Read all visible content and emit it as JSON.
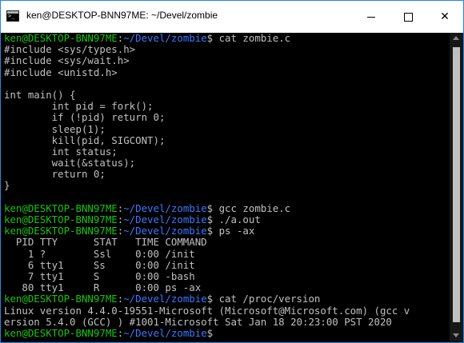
{
  "window": {
    "title": "ken@DESKTOP-BNN97ME: ~/Devel/zombie",
    "accent": "#1e88e5"
  },
  "colors": {
    "background": "#000000",
    "text": "#c0c0c0",
    "prompt_user": "#16c60c",
    "prompt_path": "#3b78ff"
  },
  "icons": {
    "app": "terminal-icon",
    "minimize": "minimize-icon",
    "maximize": "maximize-icon",
    "close": "close-icon"
  },
  "terminal": {
    "lines": [
      {
        "user": "ken@DESKTOP-BNN97ME",
        "sep": ":",
        "path": "~/Devel/zombie",
        "text": "$ cat zombie.c"
      },
      {
        "text": "#include <sys/types.h>"
      },
      {
        "text": "#include <sys/wait.h>"
      },
      {
        "text": "#include <unistd.h>"
      },
      {
        "text": ""
      },
      {
        "text": "int main() {"
      },
      {
        "text": "        int pid = fork();"
      },
      {
        "text": "        if (!pid) return 0;"
      },
      {
        "text": "        sleep(1);"
      },
      {
        "text": "        kill(pid, SIGCONT);"
      },
      {
        "text": "        int status;"
      },
      {
        "text": "        wait(&status);"
      },
      {
        "text": "        return 0;"
      },
      {
        "text": "}"
      },
      {
        "text": ""
      },
      {
        "user": "ken@DESKTOP-BNN97ME",
        "sep": ":",
        "path": "~/Devel/zombie",
        "text": "$ gcc zombie.c"
      },
      {
        "user": "ken@DESKTOP-BNN97ME",
        "sep": ":",
        "path": "~/Devel/zombie",
        "text": "$ ./a.out"
      },
      {
        "user": "ken@DESKTOP-BNN97ME",
        "sep": ":",
        "path": "~/Devel/zombie",
        "text": "$ ps -ax"
      },
      {
        "text": "  PID TTY      STAT   TIME COMMAND"
      },
      {
        "text": "    1 ?        Ssl    0:00 /init"
      },
      {
        "text": "    6 tty1     Ss     0:00 /init"
      },
      {
        "text": "    7 tty1     S      0:00 -bash"
      },
      {
        "text": "   80 tty1     R      0:00 ps -ax"
      },
      {
        "user": "ken@DESKTOP-BNN97ME",
        "sep": ":",
        "path": "~/Devel/zombie",
        "text": "$ cat /proc/version"
      },
      {
        "text": "Linux version 4.4.0-19551-Microsoft (Microsoft@Microsoft.com) (gcc v"
      },
      {
        "text": "ersion 5.4.0 (GCC) ) #1001-Microsoft Sat Jan 18 20:23:00 PST 2020"
      },
      {
        "user": "ken@DESKTOP-BNN97ME",
        "sep": ":",
        "path": "~/Devel/zombie",
        "text": "$"
      }
    ]
  }
}
